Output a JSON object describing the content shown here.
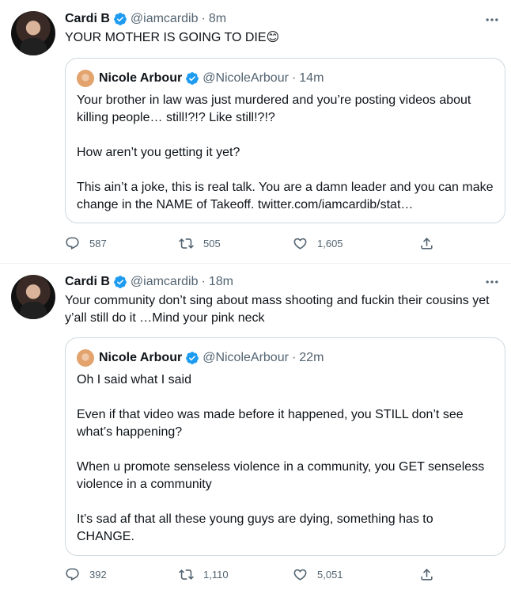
{
  "tweets": [
    {
      "author_name": "Cardi B",
      "author_handle": "@iamcardib",
      "time": "8m",
      "text": "YOUR MOTHER IS GOING TO DIE😊",
      "quote": {
        "author_name": "Nicole Arbour",
        "author_handle": "@NicoleArbour",
        "time": "14m",
        "text": "Your brother in law was just murdered and you’re posting videos about killing people… still!?!? Like still!?!?\n\nHow aren’t you getting it yet?\n\nThis ain’t a joke, this is real talk. You are a damn leader and you can make change in the NAME of Takeoff. twitter.com/iamcardib/stat…"
      },
      "replies": "587",
      "retweets": "505",
      "likes": "1,605"
    },
    {
      "author_name": "Cardi B",
      "author_handle": "@iamcardib",
      "time": "18m",
      "text": "Your community don’t sing about mass shooting and fuckin their cousins yet y’all still do it …Mind your pink neck",
      "quote": {
        "author_name": "Nicole Arbour",
        "author_handle": "@NicoleArbour",
        "time": "22m",
        "text": "Oh I said what I said\n\nEven if that video was made before it happened, you STILL don’t see what’s happening?\n\nWhen u promote senseless violence in a community, you GET senseless violence in a community\n\nIt’s sad af that all these young guys are dying, something has to CHANGE."
      },
      "replies": "392",
      "retweets": "1,110",
      "likes": "5,051"
    }
  ],
  "separator": "·",
  "colors": {
    "verified": "#1d9bf0",
    "secondary_text": "#536471",
    "primary_text": "#0f1419",
    "border": "#cfd9de"
  },
  "icons": {
    "verified": "verified-badge-icon",
    "more": "more-horizontal-icon",
    "reply": "reply-icon",
    "retweet": "retweet-icon",
    "like": "heart-icon",
    "share": "share-icon"
  }
}
